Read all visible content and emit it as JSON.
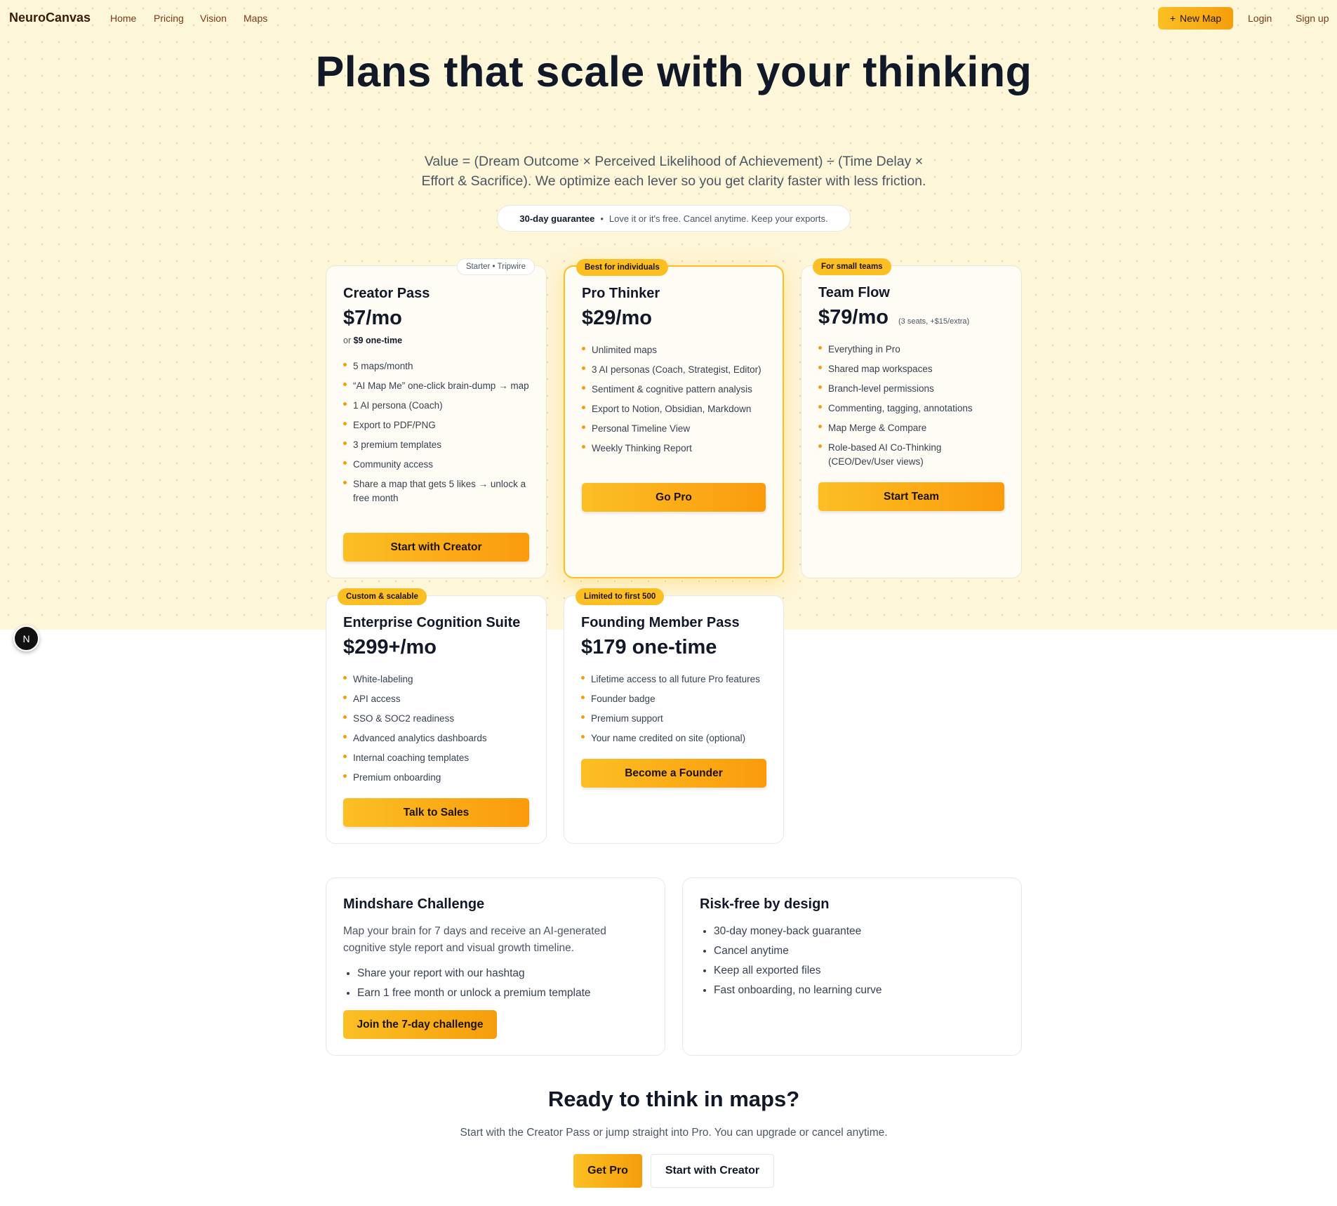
{
  "nav": {
    "brand": "NeuroCanvas",
    "links": [
      "Home",
      "Pricing",
      "Vision",
      "Maps"
    ],
    "new_map_label": "New Map",
    "login_label": "Login",
    "signup_label": "Sign up"
  },
  "hero": {
    "title": "Plans that scale with your thinking",
    "subtitle": "Value = (Dream Outcome × Perceived Likelihood of Achievement) ÷ (Time Delay × Effort & Sacrifice). We optimize each lever so you get clarity faster with less friction.",
    "guarantee_bold": "30-day guarantee",
    "guarantee_sep": "•",
    "guarantee_text": "Love it or it's free. Cancel anytime. Keep your exports."
  },
  "plans": [
    {
      "badge": "Starter • Tripwire",
      "name": "Creator Pass",
      "price": "$7/mo",
      "alt_prefix": "or",
      "alt_bold": "$9 one-time",
      "features": [
        "5 maps/month",
        "“AI Map Me” one-click brain-dump → map",
        "1 AI persona (Coach)",
        "Export to PDF/PNG",
        "3 premium templates",
        "Community access",
        "Share a map that gets 5 likes → unlock a free month"
      ],
      "cta": "Start with Creator"
    },
    {
      "badge": "Best for individuals",
      "name": "Pro Thinker",
      "price": "$29/mo",
      "features": [
        "Unlimited maps",
        "3 AI personas (Coach, Strategist, Editor)",
        "Sentiment & cognitive pattern analysis",
        "Export to Notion, Obsidian, Markdown",
        "Personal Timeline View",
        "Weekly Thinking Report"
      ],
      "cta": "Go Pro"
    },
    {
      "badge": "For small teams",
      "name": "Team Flow",
      "price": "$79/mo",
      "price_note": "(3 seats, +$15/extra)",
      "features": [
        "Everything in Pro",
        "Shared map workspaces",
        "Branch-level permissions",
        "Commenting, tagging, annotations",
        "Map Merge & Compare",
        "Role-based AI Co-Thinking (CEO/Dev/User views)"
      ],
      "cta": "Start Team"
    },
    {
      "badge": "Custom & scalable",
      "name": "Enterprise Cognition Suite",
      "price": "$299+/mo",
      "features": [
        "White-labeling",
        "API access",
        "SSO & SOC2 readiness",
        "Advanced analytics dashboards",
        "Internal coaching templates",
        "Premium onboarding"
      ],
      "cta": "Talk to Sales"
    },
    {
      "badge": "Limited to first 500",
      "name": "Founding Member Pass",
      "price": "$179 one-time",
      "features": [
        "Lifetime access to all future Pro features",
        "Founder badge",
        "Premium support",
        "Your name credited on site (optional)"
      ],
      "cta": "Become a Founder"
    }
  ],
  "challenge": {
    "title": "Mindshare Challenge",
    "text": "Map your brain for 7 days and receive an AI-generated cognitive style report and visual growth timeline.",
    "items": [
      "Share your report with our hashtag",
      "Earn 1 free month or unlock a premium template"
    ],
    "cta": "Join the 7-day challenge"
  },
  "risk": {
    "title": "Risk-free by design",
    "items": [
      "30-day money-back guarantee",
      "Cancel anytime",
      "Keep all exported files",
      "Fast onboarding, no learning curve"
    ]
  },
  "ready": {
    "title": "Ready to think in maps?",
    "subtitle": "Start with the Creator Pass or jump straight into Pro. You can upgrade or cancel anytime.",
    "primary": "Get Pro",
    "secondary": "Start with Creator"
  },
  "floating": {
    "label": "N"
  },
  "colors": {
    "accent": "#fbbf24",
    "accent_end": "#f59e0b",
    "hero_bg": "#fef6d9",
    "text": "#111827"
  }
}
